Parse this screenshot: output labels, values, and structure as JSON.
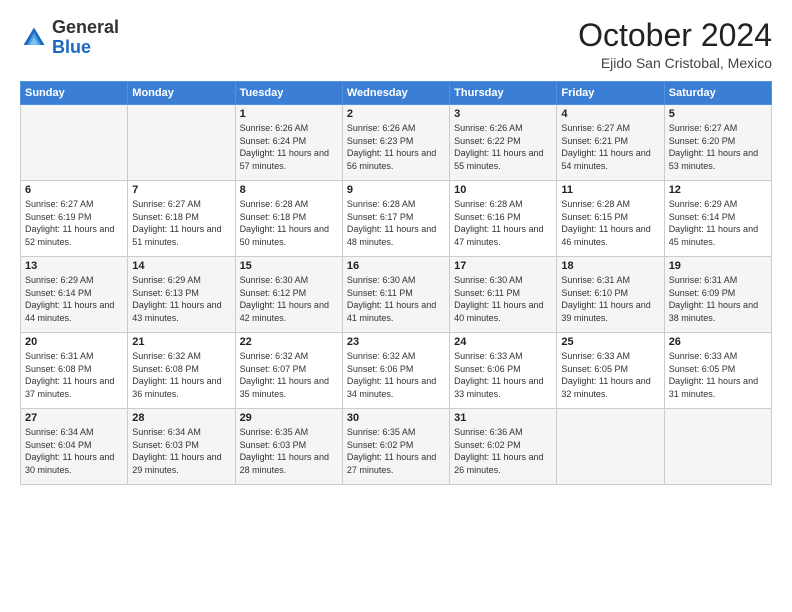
{
  "header": {
    "logo": {
      "general": "General",
      "blue": "Blue"
    },
    "title": "October 2024",
    "subtitle": "Ejido San Cristobal, Mexico"
  },
  "weekdays": [
    "Sunday",
    "Monday",
    "Tuesday",
    "Wednesday",
    "Thursday",
    "Friday",
    "Saturday"
  ],
  "weeks": [
    [
      null,
      null,
      {
        "day": 1,
        "sunrise": "6:26 AM",
        "sunset": "6:24 PM",
        "daylight": "11 hours and 57 minutes."
      },
      {
        "day": 2,
        "sunrise": "6:26 AM",
        "sunset": "6:23 PM",
        "daylight": "11 hours and 56 minutes."
      },
      {
        "day": 3,
        "sunrise": "6:26 AM",
        "sunset": "6:22 PM",
        "daylight": "11 hours and 55 minutes."
      },
      {
        "day": 4,
        "sunrise": "6:27 AM",
        "sunset": "6:21 PM",
        "daylight": "11 hours and 54 minutes."
      },
      {
        "day": 5,
        "sunrise": "6:27 AM",
        "sunset": "6:20 PM",
        "daylight": "11 hours and 53 minutes."
      }
    ],
    [
      {
        "day": 6,
        "sunrise": "6:27 AM",
        "sunset": "6:19 PM",
        "daylight": "11 hours and 52 minutes."
      },
      {
        "day": 7,
        "sunrise": "6:27 AM",
        "sunset": "6:18 PM",
        "daylight": "11 hours and 51 minutes."
      },
      {
        "day": 8,
        "sunrise": "6:28 AM",
        "sunset": "6:18 PM",
        "daylight": "11 hours and 50 minutes."
      },
      {
        "day": 9,
        "sunrise": "6:28 AM",
        "sunset": "6:17 PM",
        "daylight": "11 hours and 48 minutes."
      },
      {
        "day": 10,
        "sunrise": "6:28 AM",
        "sunset": "6:16 PM",
        "daylight": "11 hours and 47 minutes."
      },
      {
        "day": 11,
        "sunrise": "6:28 AM",
        "sunset": "6:15 PM",
        "daylight": "11 hours and 46 minutes."
      },
      {
        "day": 12,
        "sunrise": "6:29 AM",
        "sunset": "6:14 PM",
        "daylight": "11 hours and 45 minutes."
      }
    ],
    [
      {
        "day": 13,
        "sunrise": "6:29 AM",
        "sunset": "6:14 PM",
        "daylight": "11 hours and 44 minutes."
      },
      {
        "day": 14,
        "sunrise": "6:29 AM",
        "sunset": "6:13 PM",
        "daylight": "11 hours and 43 minutes."
      },
      {
        "day": 15,
        "sunrise": "6:30 AM",
        "sunset": "6:12 PM",
        "daylight": "11 hours and 42 minutes."
      },
      {
        "day": 16,
        "sunrise": "6:30 AM",
        "sunset": "6:11 PM",
        "daylight": "11 hours and 41 minutes."
      },
      {
        "day": 17,
        "sunrise": "6:30 AM",
        "sunset": "6:11 PM",
        "daylight": "11 hours and 40 minutes."
      },
      {
        "day": 18,
        "sunrise": "6:31 AM",
        "sunset": "6:10 PM",
        "daylight": "11 hours and 39 minutes."
      },
      {
        "day": 19,
        "sunrise": "6:31 AM",
        "sunset": "6:09 PM",
        "daylight": "11 hours and 38 minutes."
      }
    ],
    [
      {
        "day": 20,
        "sunrise": "6:31 AM",
        "sunset": "6:08 PM",
        "daylight": "11 hours and 37 minutes."
      },
      {
        "day": 21,
        "sunrise": "6:32 AM",
        "sunset": "6:08 PM",
        "daylight": "11 hours and 36 minutes."
      },
      {
        "day": 22,
        "sunrise": "6:32 AM",
        "sunset": "6:07 PM",
        "daylight": "11 hours and 35 minutes."
      },
      {
        "day": 23,
        "sunrise": "6:32 AM",
        "sunset": "6:06 PM",
        "daylight": "11 hours and 34 minutes."
      },
      {
        "day": 24,
        "sunrise": "6:33 AM",
        "sunset": "6:06 PM",
        "daylight": "11 hours and 33 minutes."
      },
      {
        "day": 25,
        "sunrise": "6:33 AM",
        "sunset": "6:05 PM",
        "daylight": "11 hours and 32 minutes."
      },
      {
        "day": 26,
        "sunrise": "6:33 AM",
        "sunset": "6:05 PM",
        "daylight": "11 hours and 31 minutes."
      }
    ],
    [
      {
        "day": 27,
        "sunrise": "6:34 AM",
        "sunset": "6:04 PM",
        "daylight": "11 hours and 30 minutes."
      },
      {
        "day": 28,
        "sunrise": "6:34 AM",
        "sunset": "6:03 PM",
        "daylight": "11 hours and 29 minutes."
      },
      {
        "day": 29,
        "sunrise": "6:35 AM",
        "sunset": "6:03 PM",
        "daylight": "11 hours and 28 minutes."
      },
      {
        "day": 30,
        "sunrise": "6:35 AM",
        "sunset": "6:02 PM",
        "daylight": "11 hours and 27 minutes."
      },
      {
        "day": 31,
        "sunrise": "6:36 AM",
        "sunset": "6:02 PM",
        "daylight": "11 hours and 26 minutes."
      },
      null,
      null
    ]
  ],
  "labels": {
    "sunrise": "Sunrise:",
    "sunset": "Sunset:",
    "daylight": "Daylight:"
  }
}
